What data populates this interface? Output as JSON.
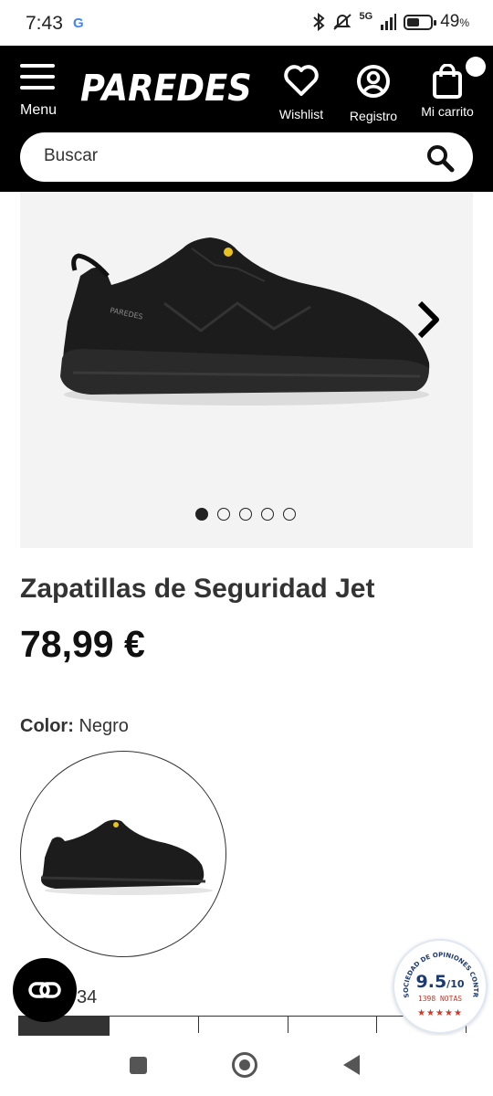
{
  "status_bar": {
    "time": "7:43",
    "google_badge": "G",
    "network": "5G",
    "battery_percent": "49",
    "battery_percent_sign": "%"
  },
  "header": {
    "menu_label": "Menu",
    "logo": "PAREDES",
    "wishlist_label": "Wishlist",
    "registro_label": "Registro",
    "cart_label": "Mi carrito",
    "search_placeholder": "Buscar"
  },
  "product": {
    "title": "Zapatillas de Seguridad Jet",
    "price": "78,99 €",
    "gallery": {
      "image_count": 5,
      "active_index": 0
    },
    "color_label": "Color:",
    "color_value": "Negro",
    "size_partial": "34"
  },
  "rating_badge": {
    "ring_text": "SOCIEDAD DE OPINIONES CONTRASTADAS",
    "score": "9.5",
    "score_scale": "/10",
    "notes": "1398 NOTAS"
  },
  "colors": {
    "header_bg": "#000000",
    "gallery_bg": "#f3f3f3",
    "badge_blue": "#1b3a73",
    "badge_red": "#c0392b"
  }
}
